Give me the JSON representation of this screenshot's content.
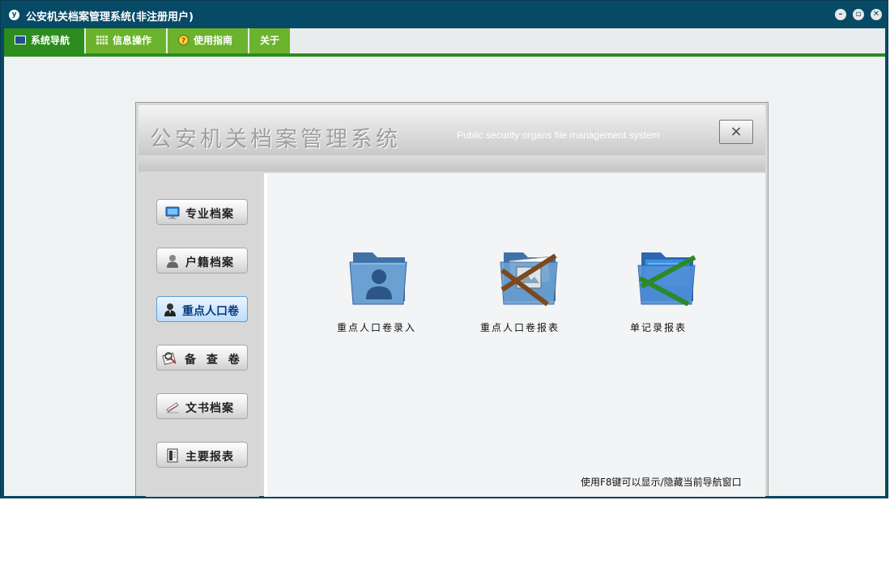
{
  "window": {
    "title": "公安机关档案管理系统(非注册用户)",
    "app_icon": "y"
  },
  "menu": {
    "items": [
      {
        "label": "系统导航",
        "icon": "monitor-icon"
      },
      {
        "label": "信息操作",
        "icon": "grid-icon"
      },
      {
        "label": "使用指南",
        "icon": "help-icon"
      },
      {
        "label": "关于"
      }
    ]
  },
  "panel": {
    "title": "公安机关档案管理系统",
    "subtitle": "Public security organs file management system",
    "close": "×"
  },
  "sidebar": {
    "items": [
      {
        "label": "专业档案",
        "icon": "monitor-icon"
      },
      {
        "label": "户籍档案",
        "icon": "person-icon"
      },
      {
        "label": "重点人口卷",
        "icon": "person-icon"
      },
      {
        "label": "备 查 卷",
        "icon": "magnifier-icon"
      },
      {
        "label": "文书档案",
        "icon": "document-icon"
      },
      {
        "label": "主要报表",
        "icon": "report-icon"
      }
    ]
  },
  "main": {
    "items": [
      {
        "label": "重点人口卷录入",
        "icon": "person-folder-icon"
      },
      {
        "label": "重点人口卷报表",
        "icon": "report-folder-icon"
      },
      {
        "label": "单记录报表",
        "icon": "record-folder-icon"
      }
    ],
    "hint": "使用F8键可以显示/隐藏当前导航窗口"
  },
  "colors": {
    "titlebar": "#074a66",
    "menu_green": "#6bb32c",
    "menu_active": "#2c8c1e",
    "folder_blue": "#5d93c4"
  }
}
